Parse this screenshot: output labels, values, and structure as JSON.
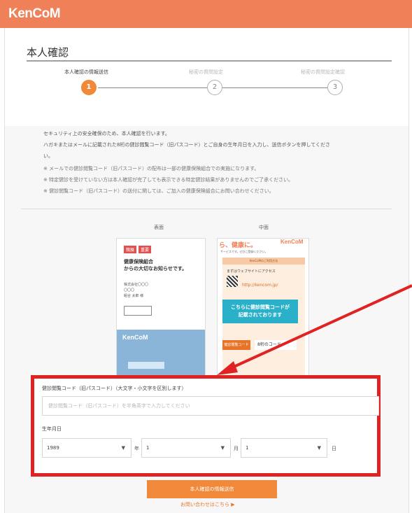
{
  "header": {
    "logo": "KenCoM"
  },
  "page": {
    "title": "本人確認"
  },
  "steps": [
    {
      "label": "本人確認の情報送信",
      "number": "1",
      "active": true
    },
    {
      "label": "秘密の質問設定",
      "number": "2",
      "active": false
    },
    {
      "label": "秘密の質問設定確認",
      "number": "3",
      "active": false
    }
  ],
  "info": {
    "line1": "セキュリティ上の安全確保のため、本人確認を行います。",
    "line2": "ハガキまたはメールに記載された8桁の健診閲覧コード（旧パスコード）とご自身の生年月日を入力し、送信ボタンを押してくださ",
    "line3": "い。",
    "note1": "※ メールでの健診閲覧コード（旧パスコード）の配布は一部の健康保険組合での実施になります。",
    "note2": "※ 特定健診を受けていない方は本人確認が完了しても表示できる特定健診結果がありませんのでご了承ください。",
    "note3": "※ 健診閲覧コード（旧パスコード）の送付に関しては、ご加入の健康保険組合にお問い合わせください。"
  },
  "cards": {
    "front_label": "表面",
    "back_label": "中面",
    "front": {
      "tags": [
        "親展",
        "重要"
      ],
      "title_line1": "健康保険組合",
      "title_line2": "からの大切なお知らせです。",
      "address_line1": "株式会社〇〇〇",
      "address_line2": "〇〇〇",
      "address_line3": "組合 太郎 様",
      "logo": "KenCoM"
    },
    "back": {
      "headline": "ら、健康に。",
      "logo": "KenCoM",
      "subline": "サービスです。ぜひご登録ください。",
      "panel_title": "KenCoMのご利用方法",
      "step1": "まずはウェブサイトにアクセス",
      "url": "http://kencom.jp/",
      "teal_line1": "こちらに健診閲覧コードが",
      "teal_line2": "記載されております",
      "code_button": "健診閲覧コード",
      "code_value": "8桁のコード"
    }
  },
  "form": {
    "code_label": "健診閲覧コード（旧パスコード）（大文字・小文字を区別します）",
    "code_placeholder": "健診閲覧コード（旧パスコード）を半角英字で入力してください",
    "birthdate_label": "生年月日",
    "year_value": "1989",
    "month_value": "1",
    "day_value": "1",
    "year_unit": "年",
    "month_unit": "月",
    "day_unit": "日",
    "caret": "▼",
    "submit_label": "本人確認の情報送信",
    "contact_link": "お問い合わせはこちら ▶"
  },
  "colors": {
    "header": "#f08058",
    "accent": "#f08a3a",
    "highlight_box": "#e12222",
    "teal": "#2ab0c8"
  }
}
